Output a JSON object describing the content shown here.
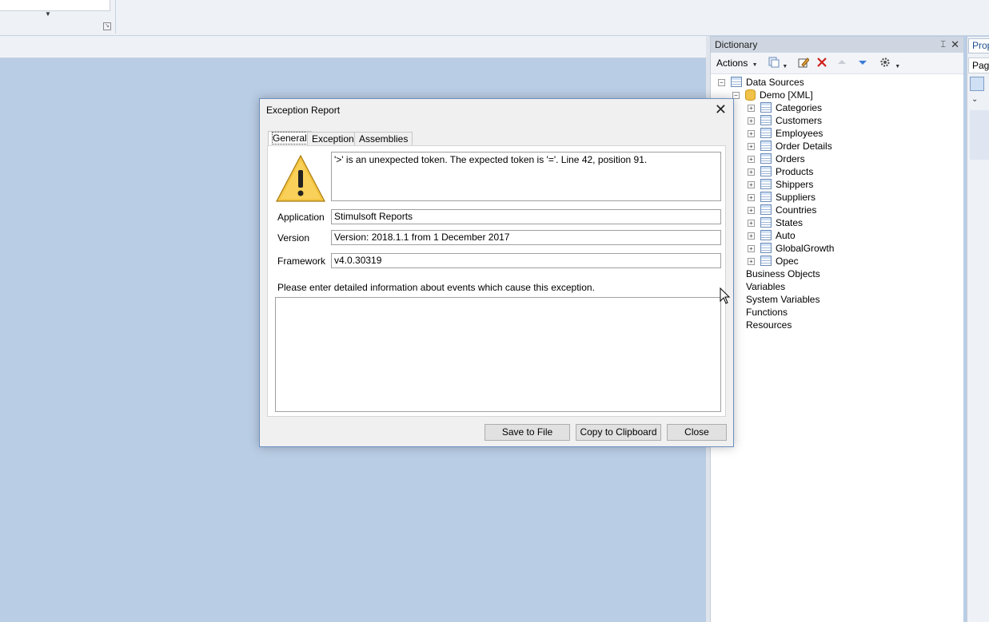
{
  "dictionary": {
    "title": "Dictionary",
    "pin_glyph": "⌶",
    "close_glyph": "✕",
    "toolbar": {
      "actions_label": "Actions"
    },
    "tree": {
      "data_sources": "Data Sources",
      "connection": "Demo [XML]",
      "tables": [
        "Categories",
        "Customers",
        "Employees",
        "Order Details",
        "Orders",
        "Products",
        "Shippers",
        "Suppliers",
        "Countries",
        "States",
        "Auto",
        "GlobalGrowth",
        "Opec"
      ],
      "business_objects": "Business Objects",
      "variables": "Variables",
      "system_variables": "System Variables",
      "functions": "Functions",
      "resources": "Resources"
    }
  },
  "properties": {
    "tab_label": "Prop",
    "page_label": "Page"
  },
  "dialog": {
    "title": "Exception Report",
    "close_glyph": "✕",
    "tabs": [
      "General",
      "Exception",
      "Assemblies"
    ],
    "message": "'>' is an unexpected token. The expected token is '='. Line 42, position 91.",
    "application_label": "Application",
    "application_value": "Stimulsoft Reports",
    "version_label": "Version",
    "version_value": "Version: 2018.1.1 from 1 December 2017",
    "framework_label": "Framework",
    "framework_value": "v4.0.30319",
    "hint": "Please enter detailed information about events which cause this exception.",
    "detail_value": "",
    "buttons": {
      "save": "Save to File",
      "copy": "Copy to Clipboard",
      "close": "Close"
    }
  },
  "colors": {
    "workspace": "#b9cde5",
    "dialog_border": "#6b8fbf",
    "warning_fill": "#f5c542"
  }
}
